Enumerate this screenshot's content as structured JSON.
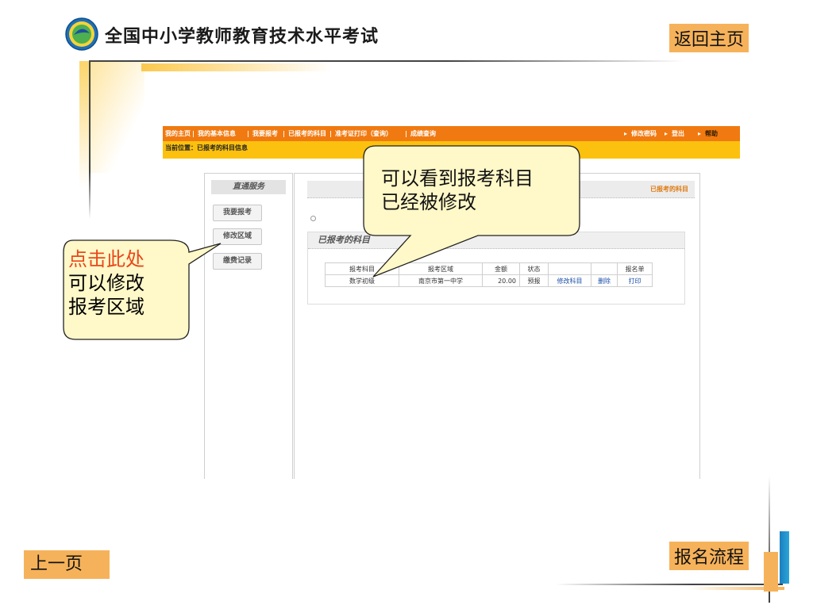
{
  "slide": {
    "title": "全国中小学教师教育技术水平考试",
    "home_button": "返回主页",
    "prev_button": "上一页",
    "flow_button": "报名流程"
  },
  "site": {
    "nav": [
      {
        "label": "我的主页"
      },
      {
        "label": "我的基本信息"
      },
      {
        "label": "我要报考"
      },
      {
        "label": "已报考的科目"
      },
      {
        "label": "准考证打印（查询）"
      },
      {
        "label": "成绩查询"
      }
    ],
    "nav_right": [
      "修改密码",
      "登出",
      "帮助"
    ],
    "location": "当前位置：已报考的科目信息",
    "sidebar": {
      "title": "直通服务",
      "items": [
        "我要报考",
        "修改区域",
        "缴费记录"
      ]
    },
    "main": {
      "header_title": "已报考的科目",
      "section_title": "已报考的科目",
      "table": {
        "headers": [
          "报考科目",
          "报考区域",
          "金额",
          "状态",
          "",
          "",
          "报名单"
        ],
        "rows": [
          {
            "subject": "数学初级",
            "region": "南京市第一中学",
            "amount": "20.00",
            "status": "预报",
            "edit": "修改科目",
            "delete": "删除",
            "print": "打印"
          }
        ]
      }
    }
  },
  "callouts": {
    "left": {
      "line1": "点击此处",
      "line2": "可以修改",
      "line3": "报考区域"
    },
    "right": {
      "line1": "可以看到报考科目",
      "line2": "已经被修改"
    }
  },
  "colors": {
    "nav_bar": "#f07a11",
    "location_bar": "#fbc10e",
    "button_bg": "#f6b25a",
    "callout_bg": "#fff8c8",
    "callout_highlight": "#e8471c",
    "link": "#1a4fa8"
  }
}
